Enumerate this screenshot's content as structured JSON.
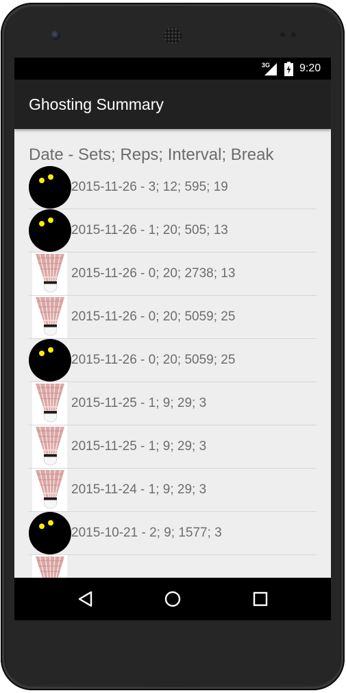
{
  "status_bar": {
    "network": "3G",
    "time": "9:20"
  },
  "app_bar": {
    "title": "Ghosting Summary"
  },
  "list": {
    "header": "Date - Sets; Reps; Interval; Break",
    "rows": [
      {
        "icon": "squash-ball-icon",
        "text": "2015-11-26 - 3; 12; 595; 19"
      },
      {
        "icon": "squash-ball-icon",
        "text": "2015-11-26 - 1; 20; 505; 13"
      },
      {
        "icon": "shuttlecock-icon",
        "text": "2015-11-26 - 0; 20; 2738; 13"
      },
      {
        "icon": "shuttlecock-icon",
        "text": "2015-11-26 - 0; 20; 5059; 25"
      },
      {
        "icon": "squash-ball-icon",
        "text": "2015-11-26 - 0; 20; 5059; 25"
      },
      {
        "icon": "shuttlecock-icon",
        "text": "2015-11-25 - 1; 9; 29; 3"
      },
      {
        "icon": "shuttlecock-icon",
        "text": "2015-11-25 - 1; 9; 29; 3"
      },
      {
        "icon": "shuttlecock-icon",
        "text": "2015-11-24 - 1; 9; 29; 3"
      },
      {
        "icon": "squash-ball-icon",
        "text": "2015-10-21 - 2; 9; 1577; 3"
      },
      {
        "icon": "shuttlecock-icon",
        "text": ""
      }
    ]
  },
  "nav_bar": {
    "back": "back-icon",
    "home": "home-icon",
    "recents": "recents-icon"
  },
  "colors": {
    "status_bar": "#000000",
    "app_bar": "#212121",
    "background": "#eeeeee",
    "text": "#6d6d6d",
    "ball_dot": "#ffee00",
    "ball": "#000000",
    "feathers": "#dca7a5"
  }
}
